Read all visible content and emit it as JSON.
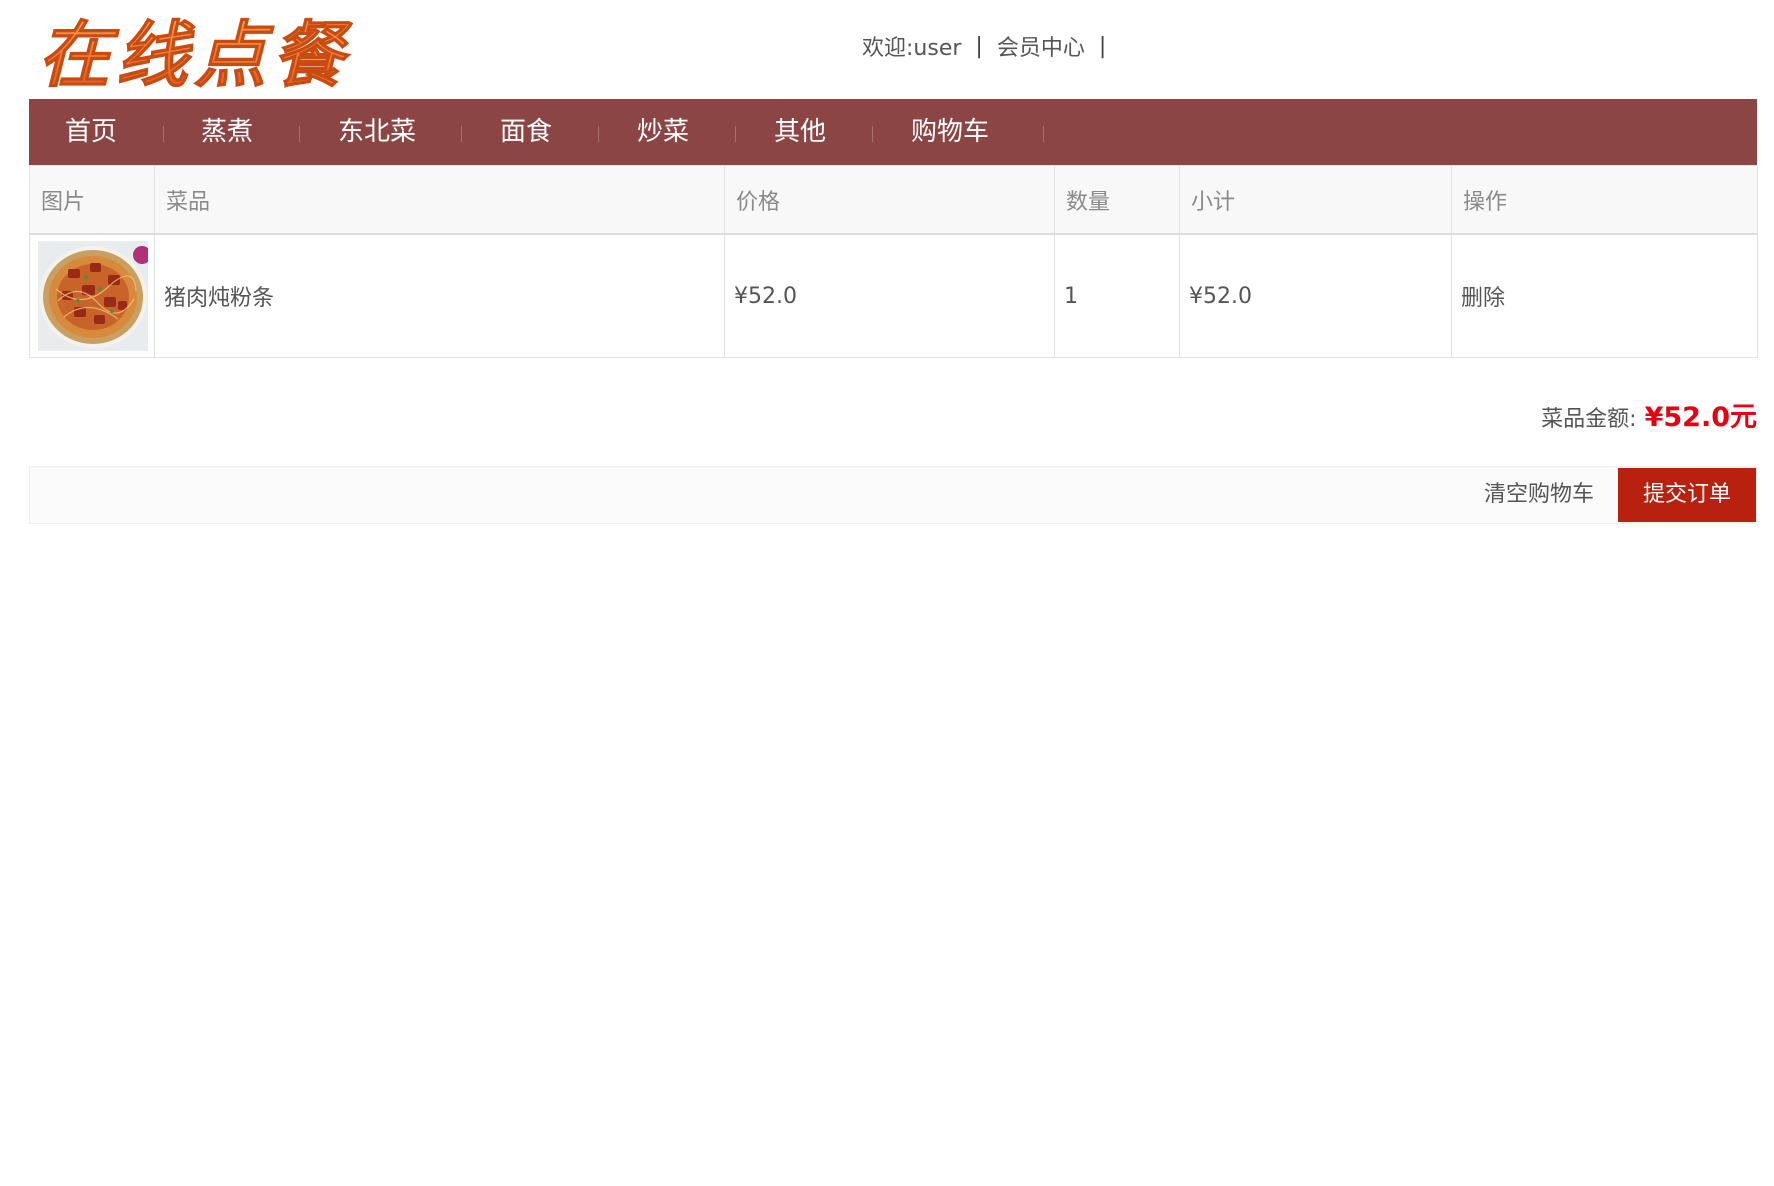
{
  "header": {
    "logo_text": "在线点餐",
    "welcome_text": "欢迎:user",
    "member_center": "会员中心",
    "separator": "|"
  },
  "nav": {
    "items": [
      {
        "label": "首页"
      },
      {
        "label": "蒸煮"
      },
      {
        "label": "东北菜"
      },
      {
        "label": "面食"
      },
      {
        "label": "炒菜"
      },
      {
        "label": "其他"
      },
      {
        "label": "购物车"
      }
    ],
    "bar_color": "#8b4545"
  },
  "cart": {
    "headers": {
      "image": "图片",
      "dish": "菜品",
      "price": "价格",
      "quantity": "数量",
      "subtotal": "小计",
      "action": "操作"
    },
    "rows": [
      {
        "image_icon": "dish-photo-pork-vermicelli",
        "dish": "猪肉炖粉条",
        "price": "¥52.0",
        "quantity": "1",
        "subtotal": "¥52.0",
        "action": "删除"
      }
    ]
  },
  "summary": {
    "total_label": "菜品金额:",
    "total_value": "¥52.0元",
    "total_color": "#e60012"
  },
  "actions": {
    "clear_cart": "清空购物车",
    "submit_order": "提交订单",
    "submit_color": "#b8210f"
  }
}
